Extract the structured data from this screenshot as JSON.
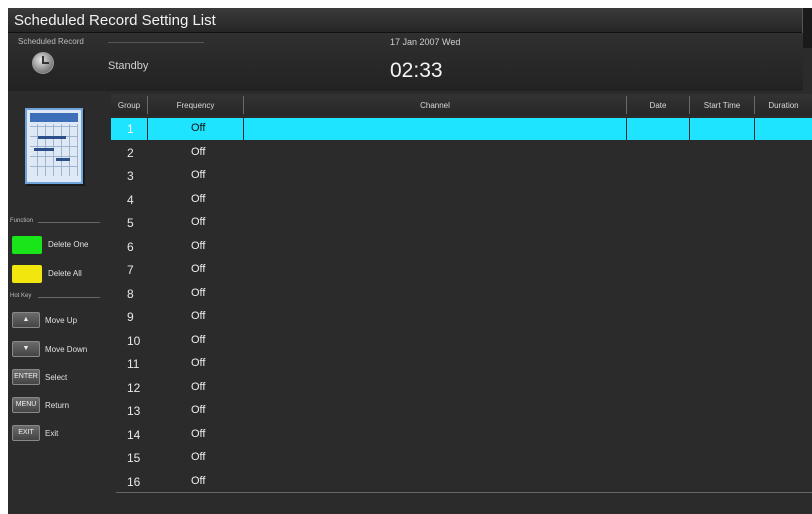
{
  "title": "Scheduled Record Setting List",
  "header": {
    "label": "Scheduled Record",
    "status": "Standby",
    "date": "17 Jan 2007 Wed",
    "time": "02:33"
  },
  "sidebar": {
    "schedule_image_label": "SCHEDULE",
    "function_label": "Function",
    "functions": [
      {
        "label": "Delete One",
        "color": "#19e619"
      },
      {
        "label": "Delete All",
        "color": "#f2e60f"
      }
    ],
    "hotkey_label": "Hot Key",
    "hotkeys": [
      {
        "key": "▲",
        "label": "Move Up",
        "icon": "up-arrow-icon"
      },
      {
        "key": "▼",
        "label": "Move Down",
        "icon": "down-arrow-icon"
      },
      {
        "key": "ENTER",
        "label": "Select",
        "icon": "enter-key-icon"
      },
      {
        "key": "MENU",
        "label": "Return",
        "icon": "menu-key-icon"
      },
      {
        "key": "EXIT",
        "label": "Exit",
        "icon": "exit-key-icon"
      }
    ]
  },
  "table": {
    "columns": [
      "Group",
      "Frequency",
      "Channel",
      "Date",
      "Start Time",
      "Duration"
    ],
    "selected_index": 0,
    "highlight_color": "#1ee4ff",
    "rows": [
      {
        "group": "1",
        "frequency": "Off"
      },
      {
        "group": "2",
        "frequency": "Off"
      },
      {
        "group": "3",
        "frequency": "Off"
      },
      {
        "group": "4",
        "frequency": "Off"
      },
      {
        "group": "5",
        "frequency": "Off"
      },
      {
        "group": "6",
        "frequency": "Off"
      },
      {
        "group": "7",
        "frequency": "Off"
      },
      {
        "group": "8",
        "frequency": "Off"
      },
      {
        "group": "9",
        "frequency": "Off"
      },
      {
        "group": "10",
        "frequency": "Off"
      },
      {
        "group": "11",
        "frequency": "Off"
      },
      {
        "group": "12",
        "frequency": "Off"
      },
      {
        "group": "13",
        "frequency": "Off"
      },
      {
        "group": "14",
        "frequency": "Off"
      },
      {
        "group": "15",
        "frequency": "Off"
      },
      {
        "group": "16",
        "frequency": "Off"
      }
    ]
  }
}
